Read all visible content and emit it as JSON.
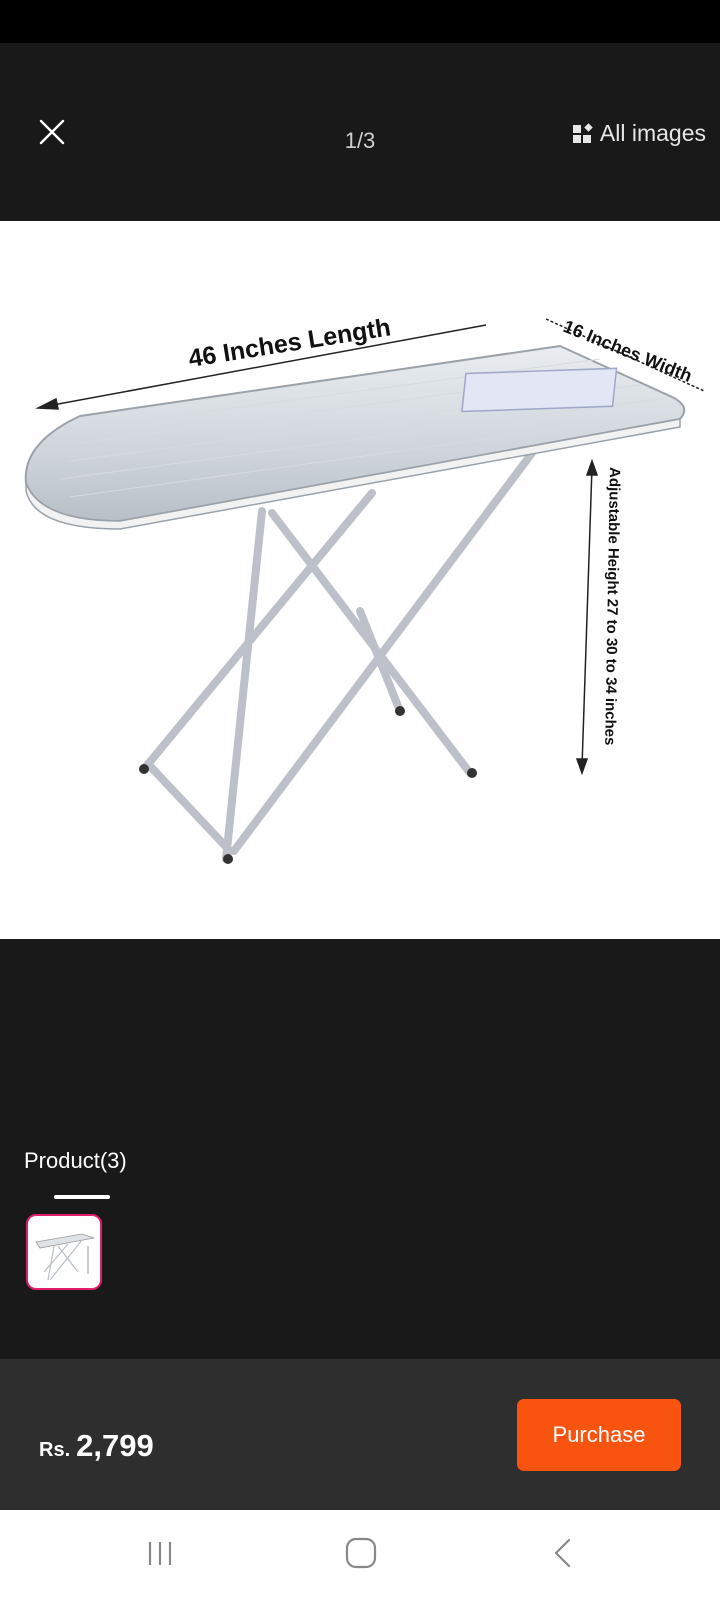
{
  "viewer": {
    "counter": "1/3",
    "all_images_label": "All images",
    "close_icon": "close-icon",
    "gallery_icon": "gallery-icon"
  },
  "product_image": {
    "length_label": "46 Inches Length",
    "width_label": "16 Inches Width",
    "height_label": "Adjustable Height 27 to 30 to 34 inches"
  },
  "tabs": {
    "product_label": "Product(3)"
  },
  "footer": {
    "currency": "Rs.",
    "price": "2,799",
    "purchase_label": "Purchase"
  },
  "nav": {
    "recents_icon": "recents-icon",
    "home_icon": "home-icon",
    "back_icon": "back-icon"
  },
  "colors": {
    "accent": "#f9540f",
    "thumb_border": "#e0206c",
    "background": "#191919",
    "footer_bg": "#2e2e2e"
  }
}
